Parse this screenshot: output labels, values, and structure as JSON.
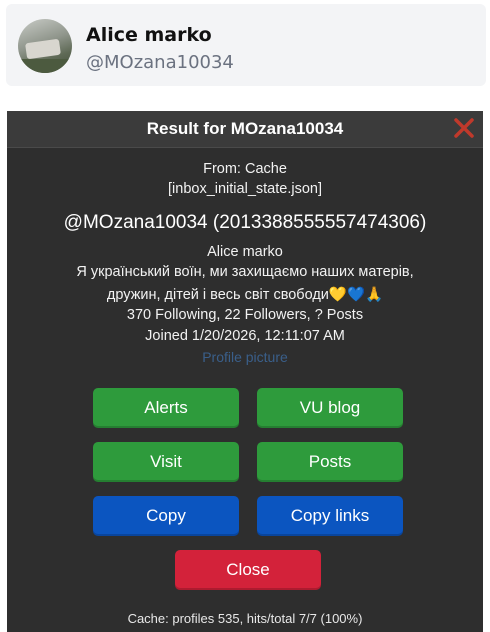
{
  "profile": {
    "display_name": "Alice marko",
    "handle": "@MOzana10034"
  },
  "dialog": {
    "title": "Result for MOzana10034",
    "from": "From: Cache",
    "source_file": "[inbox_initial_state.json]",
    "user_id_line": "@MOzana10034 (2013388555557474306)",
    "name": "Alice marko",
    "bio_line1": "Я український воїн, ми захищаємо наших матерів,",
    "bio_line2": "дружин, дітей і весь світ свободи💛💙🙏",
    "stats": "370 Following, 22 Followers, ? Posts",
    "joined": "Joined 1/20/2026, 12:11:07 AM",
    "profile_picture_link": "Profile picture",
    "buttons": {
      "alerts": "Alerts",
      "vu_blog": "VU blog",
      "visit": "Visit",
      "posts": "Posts",
      "copy": "Copy",
      "copy_links": "Copy links",
      "close": "Close"
    },
    "footer": "Cache: profiles 535, hits/total 7/7 (100%)"
  },
  "colors": {
    "dialog_bg": "#2e2e2e",
    "green_button": "#2e9b3c",
    "blue_button": "#0b55c0",
    "red_button": "#d3223a",
    "close_x": "#c0392b"
  },
  "icons": {
    "close": "close-icon"
  }
}
